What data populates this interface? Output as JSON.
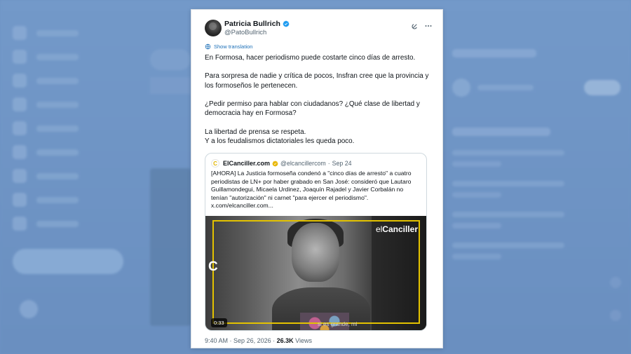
{
  "tweet": {
    "author_name": "Patricia Bullrich",
    "author_handle": "@PatoBullrich",
    "show_translation": "Show translation",
    "paragraphs": [
      "En Formosa, hacer periodismo puede costarte cinco días de arresto.",
      "Para sorpresa de nadie y crítica de pocos, Insfran cree que la provincia y los formoseños le pertenecen.",
      "¿Pedir permiso para hablar con ciudadanos? ¿Qué clase de libertad y democracia hay en Formosa?",
      "La libertad de prensa se respeta.",
      "Y a los feudalismos dictatoriales les queda poco."
    ],
    "time": "9:40 AM",
    "date": "Sep 26, 2026",
    "views_count": "26.3K",
    "views_label": "Views"
  },
  "quote": {
    "logo_letter": "C",
    "name": "ElCanciller.com",
    "handle": "@elcancillercom",
    "separator": "·",
    "date": "Sep 24",
    "text": "[AHORA] La Justicia formoseña condenó a \"cinco días de arresto\" a cuatro periodistas de LN+ por haber grabado en San José: consideró que Lautaro Guillamondegui, Micaela Urdinez, Joaquín Rajadel y Javier Corbalán no tenían \"autorización\" ni carnet \"para ejercer el periodismo\". x.com/elcanciller.com...",
    "media": {
      "brand_prefix": "el",
      "brand_name": "Canciller",
      "side_letter": "C",
      "caption": "si es grande, mi",
      "duration": "0:33"
    }
  },
  "colors": {
    "accent_yellow": "#e3c200",
    "link_blue": "#1d70b8",
    "verified_blue": "#1d9bf0",
    "gold_badge": "#e8b600",
    "backdrop": "#6d93c4"
  },
  "icons": [
    "verified-badge-icon",
    "grok-icon",
    "more-icon",
    "globe-icon",
    "gold-verified-badge-icon"
  ]
}
